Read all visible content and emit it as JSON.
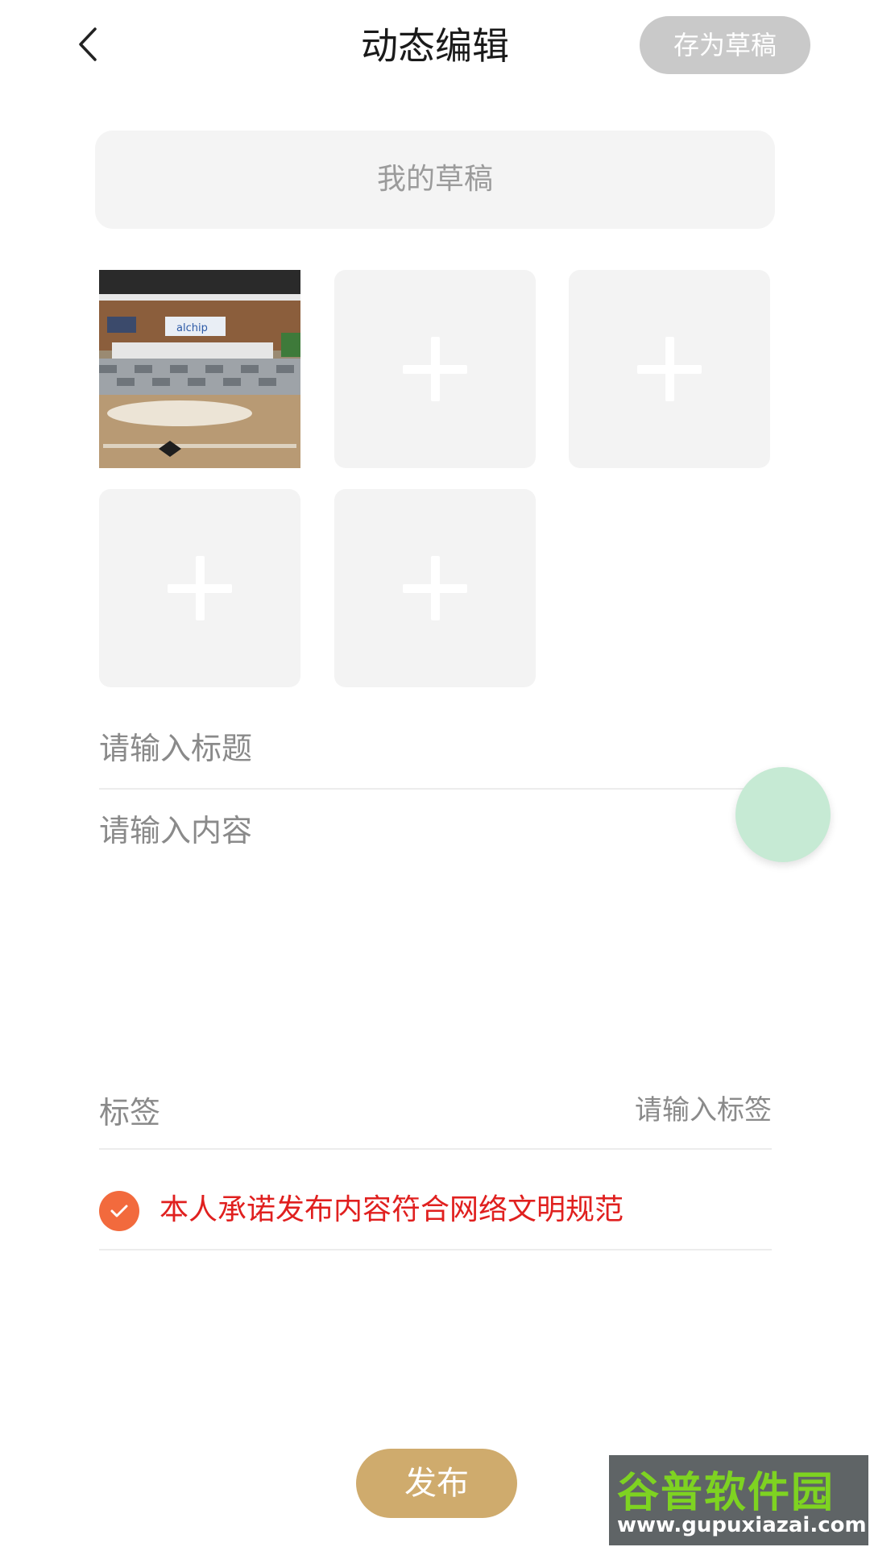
{
  "header": {
    "title": "动态编辑",
    "save_draft_label": "存为草稿"
  },
  "drafts": {
    "label": "我的草稿"
  },
  "image_grid": {
    "photo_alt": "已添加图片"
  },
  "form": {
    "title_placeholder": "请输入标题",
    "content_placeholder": "请输入内容",
    "tag_label": "标签",
    "tag_placeholder": "请输入标签"
  },
  "agreement": {
    "text": "本人承诺发布内容符合网络文明规范",
    "checked": true,
    "color": "#e0201f"
  },
  "publish": {
    "label": "发布",
    "color": "#cfab6d"
  },
  "watermark": {
    "main": "谷普软件园",
    "url": "www.gupuxiazai.com"
  }
}
